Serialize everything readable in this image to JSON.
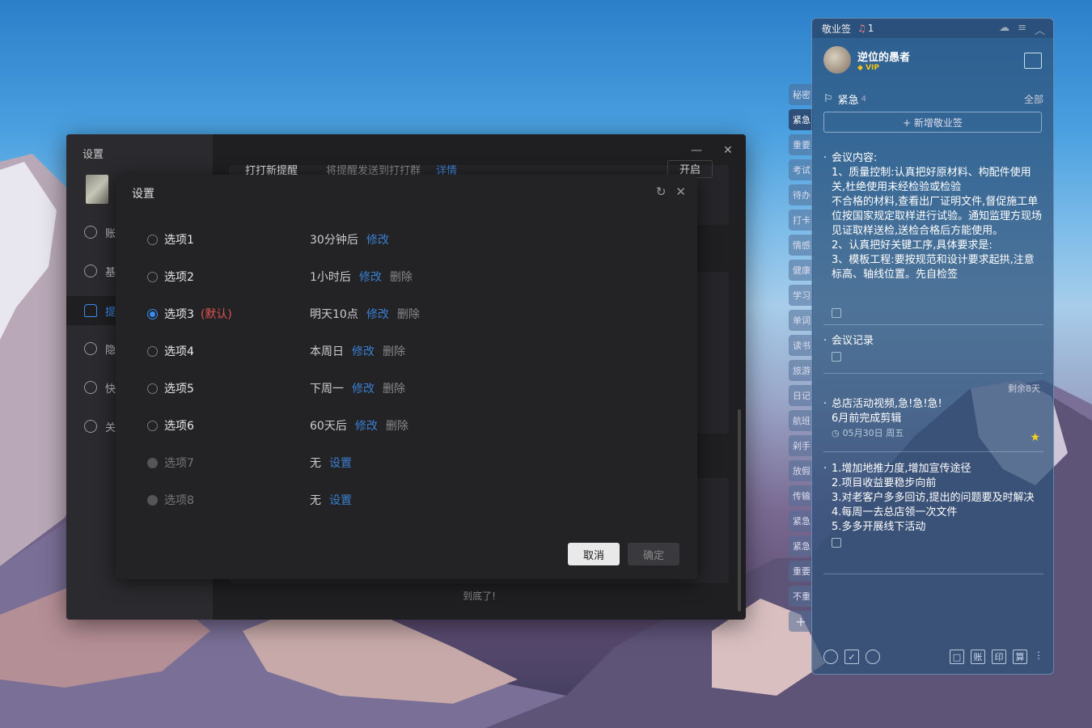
{
  "settings": {
    "title": "设置",
    "sidebar": [
      {
        "label": "账"
      },
      {
        "label": "基"
      },
      {
        "label": "提"
      },
      {
        "label": "隐"
      },
      {
        "label": "快"
      },
      {
        "label": "关"
      }
    ],
    "end_text": "到底了!",
    "bg_row_left": "打打新提醒",
    "bg_row_mid": "将提醒发送到打打群",
    "bg_row_link": "详情",
    "bg_row_btn": "开启"
  },
  "modal": {
    "title": "设置",
    "options": [
      {
        "label": "选项1",
        "value": "30分钟后",
        "edit": "修改",
        "delete": ""
      },
      {
        "label": "选项2",
        "value": "1小时后",
        "edit": "修改",
        "delete": "删除"
      },
      {
        "label": "选项3",
        "default": "(默认)",
        "value": "明天10点",
        "edit": "修改",
        "delete": "删除"
      },
      {
        "label": "选项4",
        "value": "本周日",
        "edit": "修改",
        "delete": "删除"
      },
      {
        "label": "选项5",
        "value": "下周一",
        "edit": "修改",
        "delete": "删除"
      },
      {
        "label": "选项6",
        "value": "60天后",
        "edit": "修改",
        "delete": "删除"
      },
      {
        "label": "选项7",
        "value": "无",
        "edit": "设置",
        "delete": ""
      },
      {
        "label": "选项8",
        "value": "无",
        "edit": "设置",
        "delete": ""
      }
    ],
    "cancel": "取消",
    "confirm": "确定"
  },
  "tabs": [
    "秘密",
    "紧急",
    "重要",
    "考试",
    "待办",
    "打卡",
    "情感",
    "健康",
    "学习",
    "单词",
    "读书",
    "旅游",
    "日记",
    "航班",
    "剁手",
    "放假",
    "传输",
    "紧急",
    "紧急",
    "重要",
    "不重"
  ],
  "notes": {
    "app": "敬业签",
    "bell_count": "1",
    "user": "逆位的愚者",
    "vip": "VIP",
    "section": "紧急",
    "section_count": "4",
    "filter": "全部",
    "add": "+ 新增敬业签",
    "items": [
      {
        "text": "会议内容:\n1、质量控制:认真把好原材料、构配件使用关,杜绝使用未经检验或检验\n不合格的材料,查看出厂证明文件,督促施工单位按国家规定取样进行试验。通知监理方现场见证取样送检,送检合格后方能使用。\n2、认真把好关键工序,具体要求是:\n3、模板工程:要按规范和设计要求起拱,注意标高、轴线位置。先自检签"
      },
      {
        "text": "会议记录"
      },
      {
        "text": "总店活动视频,急!急!急!\n6月前完成剪辑",
        "remain": "剩余8天",
        "date": "05月30日 周五"
      },
      {
        "text": "1.增加地推力度,增加宣传途径\n2.项目收益要稳步向前\n3.对老客户多多回访,提出的问题要及时解决\n4.每周一去总店领一次文件\n5.多多开展线下活动"
      }
    ],
    "footer_buttons": [
      "账",
      "印",
      "算"
    ]
  }
}
